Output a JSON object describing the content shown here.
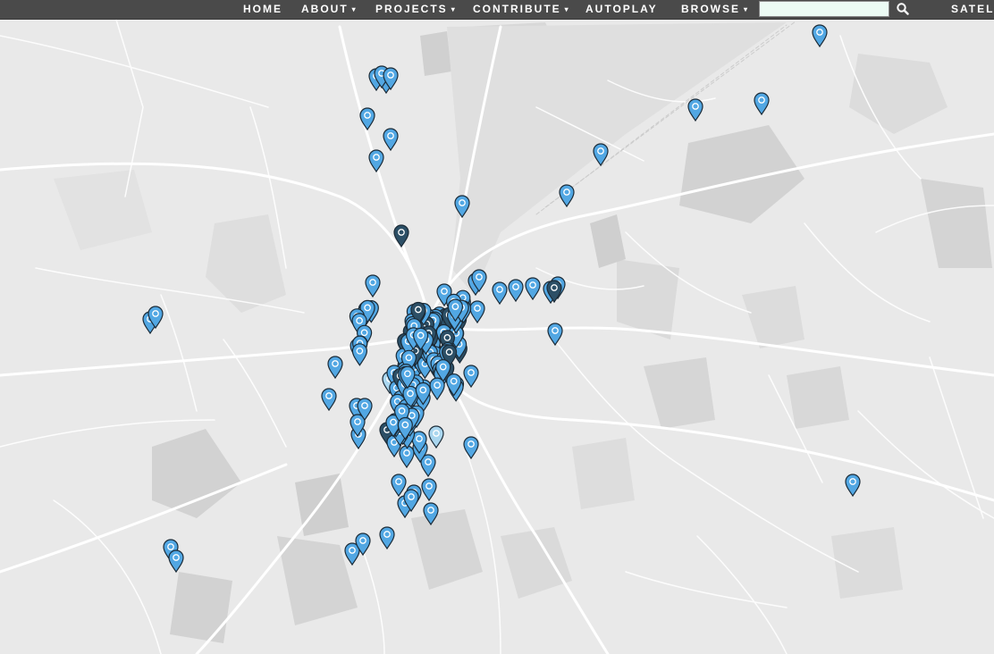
{
  "nav": {
    "home": "HOME",
    "about": "ABOUT",
    "projects": "PROJECTS",
    "contribute": "CONTRIBUTE",
    "autoplay": "AUTOPLAY",
    "browse": "BROWSE",
    "satellite": "SATELLITE",
    "caret": "▾"
  },
  "search": {
    "value": "",
    "placeholder": ""
  },
  "icons": {
    "search": "magnifier-icon",
    "marker": "map-pin-icon"
  },
  "colors": {
    "marker_blue": "#52a7e3",
    "marker_dark": "#2c4f66",
    "marker_pale": "#a9d6ef",
    "navbar": "#4a4a4a",
    "map_land": "#e9e9e9",
    "map_road": "#ffffff",
    "map_park": "#d6d6d6"
  },
  "map": {
    "style": "grayscale street map",
    "marker_count_visible": 260
  }
}
